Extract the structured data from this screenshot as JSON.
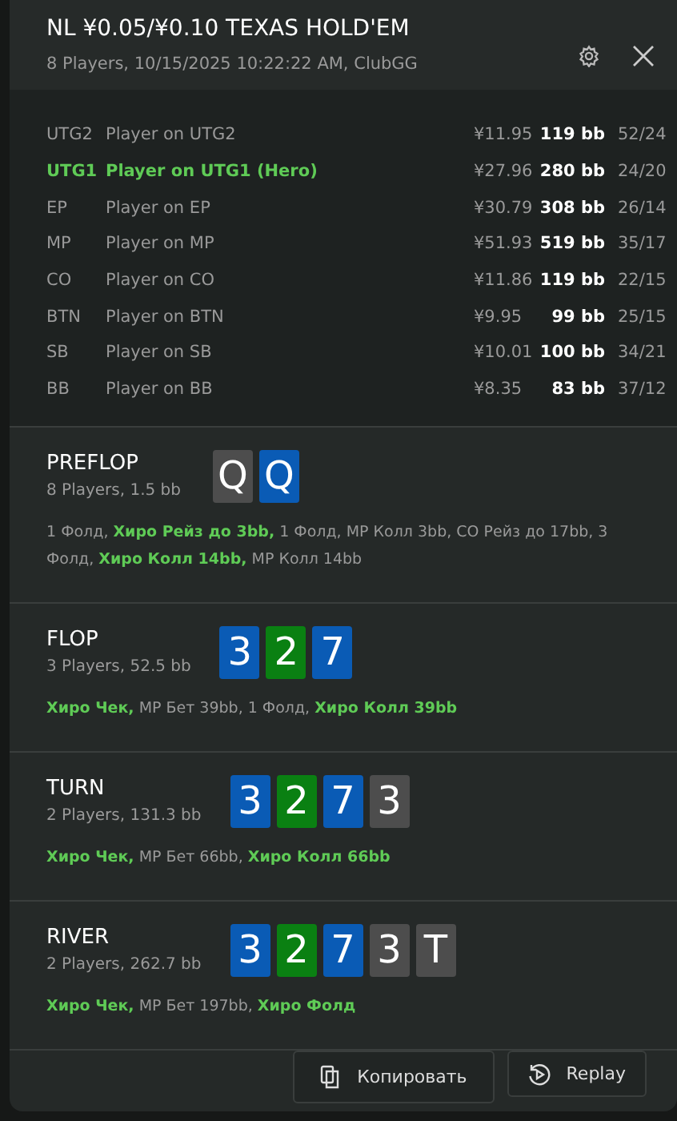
{
  "window": {
    "title": "NL ¥0.05/¥0.10 TEXAS HOLD'EM",
    "subtitle": "8 Players, 10/15/2025 10:22:22 AM, ClubGG"
  },
  "players": [
    {
      "position": "UTG2",
      "name": "Player on UTG2",
      "stack": "¥11.95",
      "bb": "119 bb",
      "stats": "52/24",
      "hero": false
    },
    {
      "position": "UTG1",
      "name": "Player on UTG1 (Hero)",
      "stack": "¥27.96",
      "bb": "280 bb",
      "stats": "24/20",
      "hero": true
    },
    {
      "position": "EP",
      "name": "Player on EP",
      "stack": "¥30.79",
      "bb": "308 bb",
      "stats": "26/14",
      "hero": false
    },
    {
      "position": "MP",
      "name": "Player on MP",
      "stack": "¥51.93",
      "bb": "519 bb",
      "stats": "35/17",
      "hero": false
    },
    {
      "position": "CO",
      "name": "Player on CO",
      "stack": "¥11.86",
      "bb": "119 bb",
      "stats": "22/15",
      "hero": false
    },
    {
      "position": "BTN",
      "name": "Player on BTN",
      "stack": "¥9.95",
      "bb": "99 bb",
      "stats": "25/15",
      "hero": false
    },
    {
      "position": "SB",
      "name": "Player on SB",
      "stack": "¥10.01",
      "bb": "100 bb",
      "stats": "34/21",
      "hero": false
    },
    {
      "position": "BB",
      "name": "Player on BB",
      "stack": "¥8.35",
      "bb": "83 bb",
      "stats": "37/12",
      "hero": false
    }
  ],
  "streets": [
    {
      "name": "PREFLOP",
      "info": "8 Players, 1.5 bb",
      "cards": [
        {
          "rank": "Q",
          "color": "#4d4d4d"
        },
        {
          "rank": "Q",
          "color": "#0a5bb5"
        }
      ],
      "actions": "1 Фолд, **Хиро Рейз до 3bb,** 1 Фолд, MP Колл 3bb, CO Рейз до 17bb, 3 Фолд, **Хиро Колл 14bb,** MP Колл 14bb"
    },
    {
      "name": "FLOP",
      "info": "3 Players, 52.5 bb",
      "cards": [
        {
          "rank": "3",
          "color": "#0a5bb5"
        },
        {
          "rank": "2",
          "color": "#0a8012"
        },
        {
          "rank": "7",
          "color": "#0a5bb5"
        }
      ],
      "actions": "**Хиро Чек,** MP Бет 39bb, 1 Фолд, **Хиро Колл 39bb**"
    },
    {
      "name": "TURN",
      "info": "2 Players, 131.3 bb",
      "cards": [
        {
          "rank": "3",
          "color": "#0a5bb5"
        },
        {
          "rank": "2",
          "color": "#0a8012"
        },
        {
          "rank": "7",
          "color": "#0a5bb5"
        },
        {
          "rank": "3",
          "color": "#4d4d4d"
        }
      ],
      "actions": "**Хиро Чек,** MP Бет 66bb, **Хиро Колл 66bb**"
    },
    {
      "name": "RIVER",
      "info": "2 Players, 262.7 bb",
      "cards": [
        {
          "rank": "3",
          "color": "#0a5bb5"
        },
        {
          "rank": "2",
          "color": "#0a8012"
        },
        {
          "rank": "7",
          "color": "#0a5bb5"
        },
        {
          "rank": "3",
          "color": "#4d4d4d"
        },
        {
          "rank": "T",
          "color": "#4d4d4d"
        }
      ],
      "actions": "**Хиро Чек,** MP Бет 197bb, **Хиро Фолд**"
    }
  ],
  "buttons": [
    {
      "kind": "copy",
      "label": "Копировать"
    },
    {
      "kind": "replay",
      "label": "Replay"
    }
  ]
}
